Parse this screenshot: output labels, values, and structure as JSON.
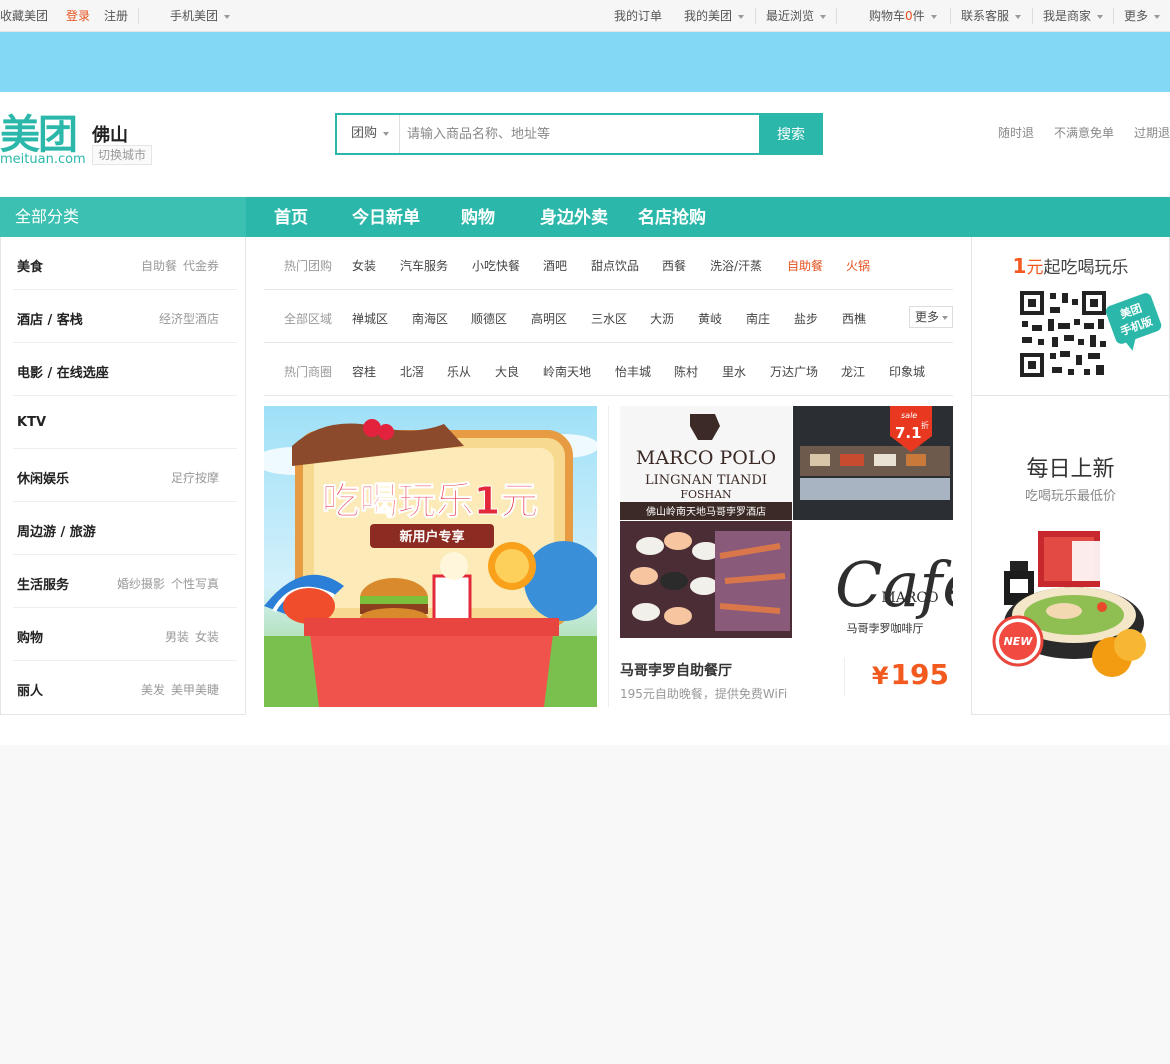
{
  "topbar": {
    "favorite": "收藏美团",
    "login": "登录",
    "register": "注册",
    "mobile": "手机美团",
    "orders": "我的订单",
    "my_meituan": "我的美团",
    "recent": "最近浏览",
    "cart_prefix": "购物车",
    "cart_count": "0",
    "cart_suffix": "件",
    "service": "联系客服",
    "merchant": "我是商家",
    "more": "更多"
  },
  "header": {
    "logo_cn": "美团",
    "logo_en": "meituan.com",
    "city": "佛山",
    "switch_city": "切换城市",
    "search_type": "团购",
    "search_placeholder": "请输入商品名称、地址等",
    "search_button": "搜索",
    "promises": [
      "随时退",
      "不满意免单",
      "过期退"
    ]
  },
  "nav": {
    "all_categories": "全部分类",
    "items": [
      "首页",
      "今日新单",
      "购物",
      "身边外卖",
      "名店抢购"
    ]
  },
  "sidebar": {
    "categories": [
      {
        "name": "美食",
        "subs": [
          "自助餐",
          "代金券"
        ]
      },
      {
        "name": "酒店 / 客栈",
        "subs": [
          "经济型酒店"
        ]
      },
      {
        "name": "电影 / 在线选座",
        "subs": []
      },
      {
        "name": "KTV",
        "subs": []
      },
      {
        "name": "休闲娱乐",
        "subs": [
          "足疗按摩"
        ]
      },
      {
        "name": "周边游 / 旅游",
        "subs": []
      },
      {
        "name": "生活服务",
        "subs": [
          "婚纱摄影",
          "个性写真"
        ]
      },
      {
        "name": "购物",
        "subs": [
          "男装",
          "女装"
        ]
      },
      {
        "name": "丽人",
        "subs": [
          "美发",
          "美甲美睫"
        ]
      }
    ]
  },
  "filters": {
    "hot_deals": {
      "label": "热门团购",
      "options": [
        "女装",
        "汽车服务",
        "小吃快餐",
        "酒吧",
        "甜点饮品",
        "西餐",
        "洗浴/汗蒸",
        "自助餐",
        "火锅"
      ]
    },
    "areas": {
      "label": "全部区域",
      "options": [
        "禅城区",
        "南海区",
        "顺德区",
        "高明区",
        "三水区",
        "大沥",
        "黄岐",
        "南庄",
        "盐步",
        "西樵"
      ],
      "more": "更多"
    },
    "hot_districts": {
      "label": "热门商圈",
      "options": [
        "容桂",
        "北滘",
        "乐从",
        "大良",
        "岭南天地",
        "怡丰城",
        "陈村",
        "里水",
        "万达广场",
        "龙江",
        "印象城"
      ]
    }
  },
  "promo": {
    "headline": "吃喝玩乐1元",
    "ribbon": "新用户专享"
  },
  "deal": {
    "hotel_name_1": "MARCO POLO",
    "hotel_name_2": "LINGNAN TIANDI",
    "hotel_name_3": "FOSHAN",
    "hotel_cn": "佛山岭南天地马哥孛罗酒店",
    "sale_tag": "sale",
    "discount": "7.1",
    "discount_unit": "折",
    "cafe_word": "Cafe",
    "cafe_brand": "MARCO",
    "cafe_cn": "马哥孛罗咖啡厅",
    "title": "马哥孛罗自助餐厅",
    "desc": "195元自助晚餐，提供免费WiFi",
    "currency": "¥",
    "price": "195"
  },
  "right": {
    "one_num": "1",
    "one_unit": "元",
    "one_rest": "起吃喝玩乐",
    "app_badge_1": "美团",
    "app_badge_2": "手机版",
    "daily_title": "每日上新",
    "daily_sub": "吃喝玩乐最低价",
    "new_badge": "NEW"
  },
  "colors": {
    "brand": "#2bb8aa",
    "accent": "#f25a20",
    "banner": "#82d8f5"
  }
}
